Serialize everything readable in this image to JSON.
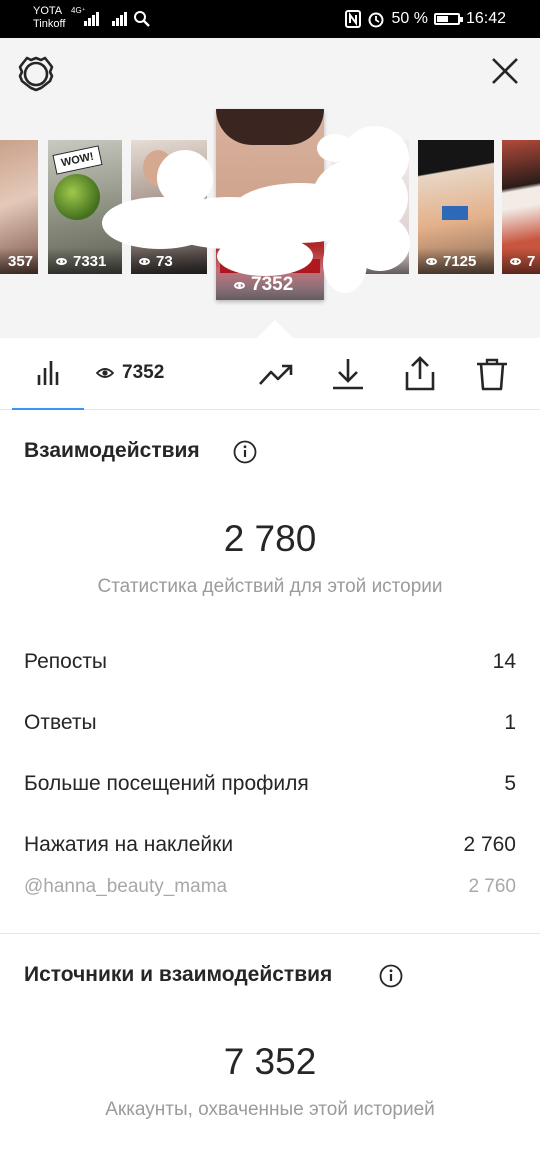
{
  "status_bar": {
    "carrier_1": "YOTA",
    "carrier_2": "Tinkoff",
    "network": "4G⁺",
    "battery": "50 %",
    "time": "16:42"
  },
  "stories": [
    {
      "views": "357"
    },
    {
      "views": "7331"
    },
    {
      "views": "73"
    },
    {
      "views": "7352"
    },
    {
      "views": ""
    },
    {
      "views": "7125"
    },
    {
      "views": "7"
    }
  ],
  "tabs": {
    "views_count": "7352"
  },
  "interactions": {
    "title": "Взаимодействия",
    "total": "2 780",
    "caption": "Статистика действий для этой истории",
    "rows": [
      {
        "label": "Репосты",
        "value": "14"
      },
      {
        "label": "Ответы",
        "value": "1"
      },
      {
        "label": "Больше посещений профиля",
        "value": "5"
      },
      {
        "label": "Нажатия на наклейки",
        "value": "2 760"
      }
    ],
    "mention": {
      "label": "@hanna_beauty_mama",
      "value": "2 760"
    }
  },
  "discovery": {
    "title": "Источники и взаимодействия",
    "total": "7 352",
    "caption": "Аккаунты, охваченные этой историей"
  },
  "colors": {
    "accent": "#3897f0",
    "text": "#262626",
    "muted": "#9b9b9b",
    "header_bg": "#f4f4f4"
  }
}
